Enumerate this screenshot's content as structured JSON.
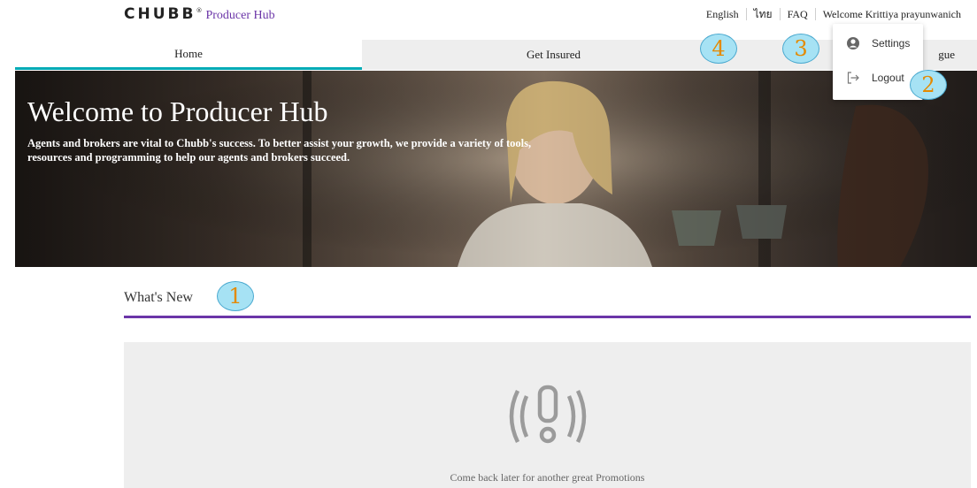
{
  "header": {
    "logo_text": "CHUBB",
    "logo_mark": "®",
    "product_name": "Producer Hub",
    "utility": {
      "english": "English",
      "thai": "ไทย",
      "faq": "FAQ",
      "welcome": "Welcome Krittiya prayunwanich"
    }
  },
  "nav": {
    "tabs": [
      {
        "label": "Home",
        "active": true
      },
      {
        "label": "Get Insured",
        "active": false
      },
      {
        "label": "gue",
        "active": false
      }
    ]
  },
  "user_menu": {
    "items": [
      {
        "label": "Settings",
        "icon": "user-circle-icon"
      },
      {
        "label": "Logout",
        "icon": "logout-icon"
      }
    ]
  },
  "hero": {
    "title": "Welcome to Producer Hub",
    "body": "Agents and brokers are vital to Chubb's success. To better assist your growth, we provide a variety of tools, resources and programming to help our agents and brokers succeed."
  },
  "whats_new": {
    "title": "What's New",
    "empty_icon": "alert-exclamation-icon",
    "empty_message": "Come back later for another great Promotions"
  },
  "callouts": [
    "1",
    "2",
    "3",
    "4"
  ],
  "colors": {
    "brand_purple": "#6b35a8",
    "active_tab_accent": "#00aab5",
    "callout_fill": "#a6e2f4",
    "callout_number": "#e48a00"
  }
}
